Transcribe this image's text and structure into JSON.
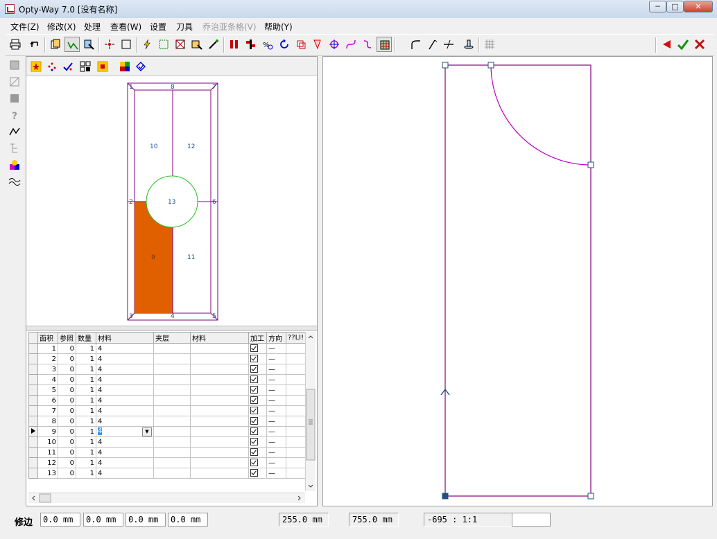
{
  "window": {
    "title": "Opty-Way 7.0  [没有名称]",
    "min": "─",
    "max": "□",
    "close": "✕"
  },
  "menu": [
    {
      "label": "文件(Z)",
      "disabled": false
    },
    {
      "label": "修改(X)",
      "disabled": false
    },
    {
      "label": "处理",
      "disabled": false
    },
    {
      "label": "查看(W)",
      "disabled": false
    },
    {
      "label": "设置",
      "disabled": false
    },
    {
      "label": "刀具",
      "disabled": false
    },
    {
      "label": "乔治亚条格(V)",
      "disabled": true
    },
    {
      "label": "帮助(Y)",
      "disabled": false
    }
  ],
  "preview": {
    "labels": [
      "1",
      "8",
      "7",
      "10",
      "12",
      "2",
      "13",
      "6",
      "9",
      "11",
      "3",
      "4",
      "5"
    ],
    "fill_color": "#e06000",
    "outline_color": "#800080",
    "circle_color": "#22c022"
  },
  "grid": {
    "headers": [
      "面积",
      "参照",
      "数量",
      "材料",
      "夹层",
      "材料",
      "加工",
      "方向",
      "??LI!"
    ],
    "rows": [
      {
        "area": "1",
        "ref": "0",
        "qty": "1",
        "material": "4",
        "dir": "—"
      },
      {
        "area": "2",
        "ref": "0",
        "qty": "1",
        "material": "4",
        "dir": "—"
      },
      {
        "area": "3",
        "ref": "0",
        "qty": "1",
        "material": "4",
        "dir": "—"
      },
      {
        "area": "4",
        "ref": "0",
        "qty": "1",
        "material": "4",
        "dir": "—"
      },
      {
        "area": "5",
        "ref": "0",
        "qty": "1",
        "material": "4",
        "dir": "—"
      },
      {
        "area": "6",
        "ref": "0",
        "qty": "1",
        "material": "4",
        "dir": "—"
      },
      {
        "area": "7",
        "ref": "0",
        "qty": "1",
        "material": "4",
        "dir": "—"
      },
      {
        "area": "8",
        "ref": "0",
        "qty": "1",
        "material": "4",
        "dir": "—"
      },
      {
        "area": "9",
        "ref": "0",
        "qty": "1",
        "material": "4",
        "dir": "—",
        "current": true
      },
      {
        "area": "10",
        "ref": "0",
        "qty": "1",
        "material": "4",
        "dir": "—"
      },
      {
        "area": "11",
        "ref": "0",
        "qty": "1",
        "material": "4",
        "dir": "—"
      },
      {
        "area": "12",
        "ref": "0",
        "qty": "1",
        "material": "4",
        "dir": "—"
      },
      {
        "area": "13",
        "ref": "0",
        "qty": "1",
        "material": "4",
        "dir": "—"
      }
    ]
  },
  "status": {
    "label": "修边",
    "fields": [
      "0.0 mm",
      "0.0 mm",
      "0.0 mm",
      "0.0 mm"
    ],
    "width": "255.0 mm",
    "height": "755.0 mm",
    "coord": "-695 :   1:1",
    "extra": ""
  },
  "colors": {
    "shape": "#800080",
    "arc": "#c000c0",
    "accent_red": "#d01010",
    "accent_green": "#109010"
  }
}
